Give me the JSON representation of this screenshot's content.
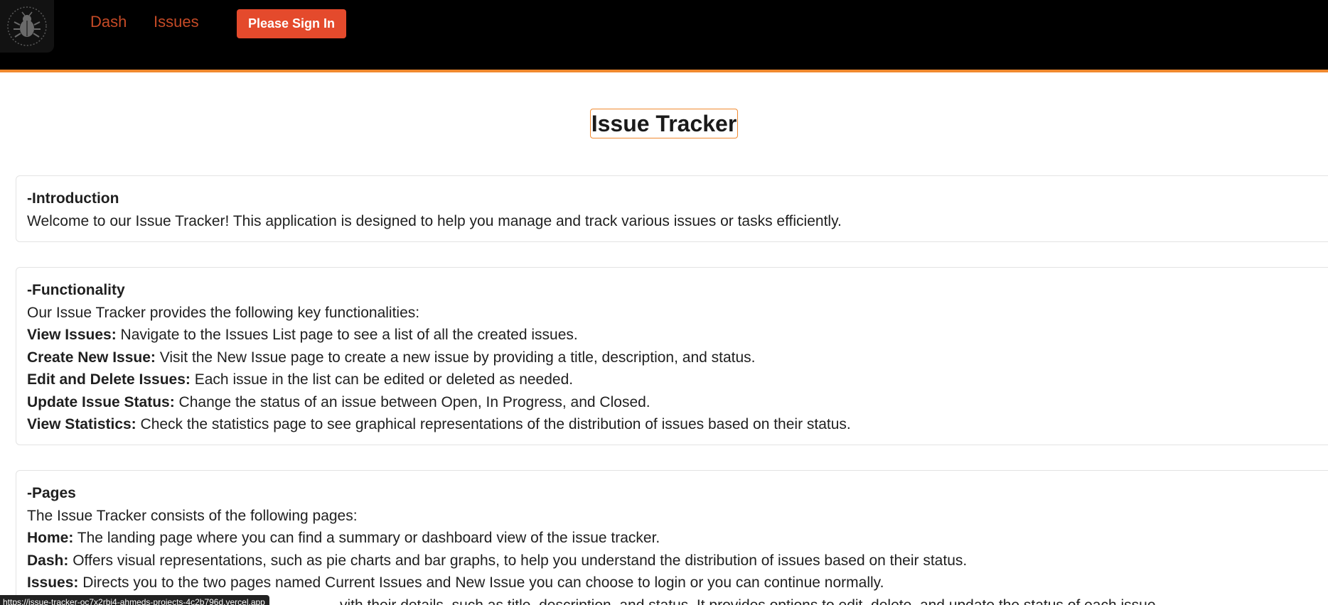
{
  "nav": {
    "dash": "Dash",
    "issues": "Issues",
    "sign_in": "Please Sign In",
    "logo_icon": "bug-icon"
  },
  "main": {
    "title": "Issue Tracker"
  },
  "sections": {
    "introduction": {
      "heading": "-Introduction",
      "text": "Welcome to our Issue Tracker! This application is designed to help you manage and track various issues or tasks efficiently."
    },
    "functionality": {
      "heading": "-Functionality",
      "intro": "Our Issue Tracker provides the following key functionalities:",
      "items": [
        {
          "label": "View Issues:",
          "text": " Navigate to the Issues List page to see a list of all the created issues."
        },
        {
          "label": "Create New Issue:",
          "text": " Visit the New Issue page to create a new issue by providing a title, description, and status."
        },
        {
          "label": "Edit and Delete Issues:",
          "text": " Each issue in the list can be edited or deleted as needed."
        },
        {
          "label": "Update Issue Status:",
          "text": " Change the status of an issue between Open, In Progress, and Closed."
        },
        {
          "label": "View Statistics:",
          "text": " Check the statistics page to see graphical representations of the distribution of issues based on their status."
        }
      ]
    },
    "pages": {
      "heading": "-Pages",
      "intro": "The Issue Tracker consists of the following pages:",
      "items": [
        {
          "label": "Home:",
          "text": " The landing page where you can find a summary or dashboard view of the issue tracker."
        },
        {
          "label": "Dash:",
          "text": " Offers visual representations, such as pie charts and bar graphs, to help you understand the distribution of issues based on their status."
        },
        {
          "label": "Issues:",
          "text": " Directs you to the two pages named Current Issues and New Issue you can choose to login or you can continue normally."
        },
        {
          "label": "",
          "text": "vith their details, such as title, description, and status. It provides options to edit, delete, and update the status of each issue."
        }
      ]
    }
  },
  "status_bar": {
    "url": "https://issue-tracker-oc7x2rbi4-ahmeds-projects-4c2b796d.vercel.app"
  },
  "colors": {
    "header_bg": "#000000",
    "accent": "#f0892f",
    "nav_link": "#c54a26",
    "button": "#e44a2c"
  }
}
